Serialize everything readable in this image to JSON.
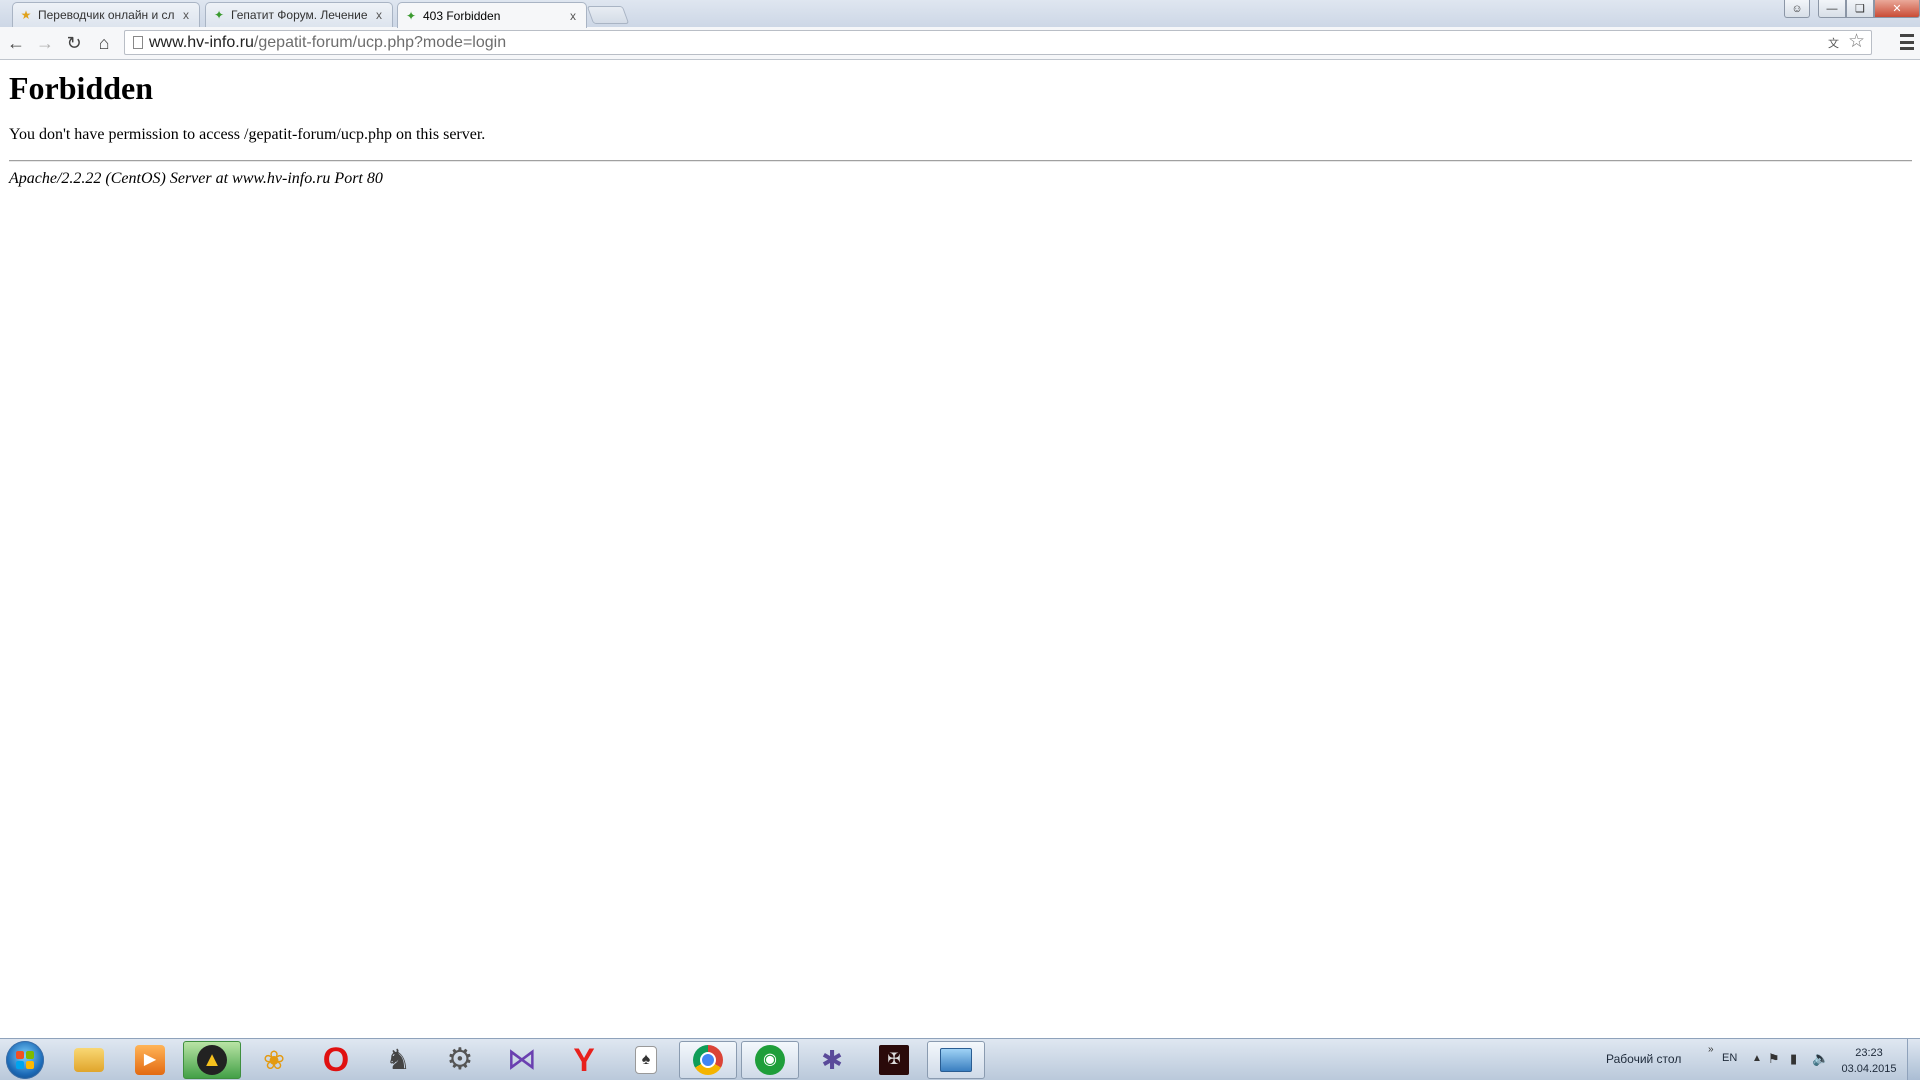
{
  "browser": {
    "tabs": [
      {
        "title": "Переводчик онлайн и сл",
        "favicon": "translate-favicon-icon",
        "active": false
      },
      {
        "title": "Гепатит Форум. Лечение",
        "favicon": "leaf-favicon-icon",
        "active": false
      },
      {
        "title": "403 Forbidden",
        "favicon": "leaf-favicon-icon",
        "active": true
      }
    ],
    "close_glyph": "x",
    "url_host": "www.hv-info.ru",
    "url_path": "/gepatit-forum/ucp.php?mode=login",
    "icons": {
      "back": "back-arrow-icon",
      "forward": "forward-arrow-icon",
      "reload": "reload-icon",
      "home": "home-icon",
      "page": "page-icon",
      "translate": "translate-icon",
      "bookmark": "star-icon",
      "menu": "menu-icon"
    }
  },
  "page": {
    "heading": "Forbidden",
    "message": "You don't have permission to access /gepatit-forum/ucp.php on this server.",
    "address": "Apache/2.2.22 (CentOS) Server at www.hv-info.ru Port 80"
  },
  "taskbar": {
    "items": [
      {
        "name": "explorer-icon",
        "state": "pinned"
      },
      {
        "name": "media-player-icon",
        "state": "pinned"
      },
      {
        "name": "aimp-icon",
        "state": "pressed"
      },
      {
        "name": "puzzle-app-icon",
        "state": "pinned"
      },
      {
        "name": "opera-icon",
        "state": "pinned"
      },
      {
        "name": "chess-icon",
        "state": "pinned"
      },
      {
        "name": "settings-gear-icon",
        "state": "pinned"
      },
      {
        "name": "visual-studio-icon",
        "state": "pinned"
      },
      {
        "name": "yandex-browser-icon",
        "state": "pinned"
      },
      {
        "name": "solitaire-icon",
        "state": "pinned"
      },
      {
        "name": "chrome-icon",
        "state": "running"
      },
      {
        "name": "radio-icon",
        "state": "running"
      },
      {
        "name": "spider-icon",
        "state": "pinned"
      },
      {
        "name": "dark-app-icon",
        "state": "pinned"
      },
      {
        "name": "picture-viewer-icon",
        "state": "running"
      }
    ],
    "tray": {
      "desktop_label": "Рабочий стол",
      "chevron": "»",
      "language": "EN",
      "time": "23:23",
      "date": "03.04.2015"
    }
  },
  "colors": {
    "tab_active_bg": "#f6f7f9",
    "taskbar_bg": "#c9d6e6",
    "close_button": "#c94c35",
    "favicon_green": "#3a9a2f"
  }
}
